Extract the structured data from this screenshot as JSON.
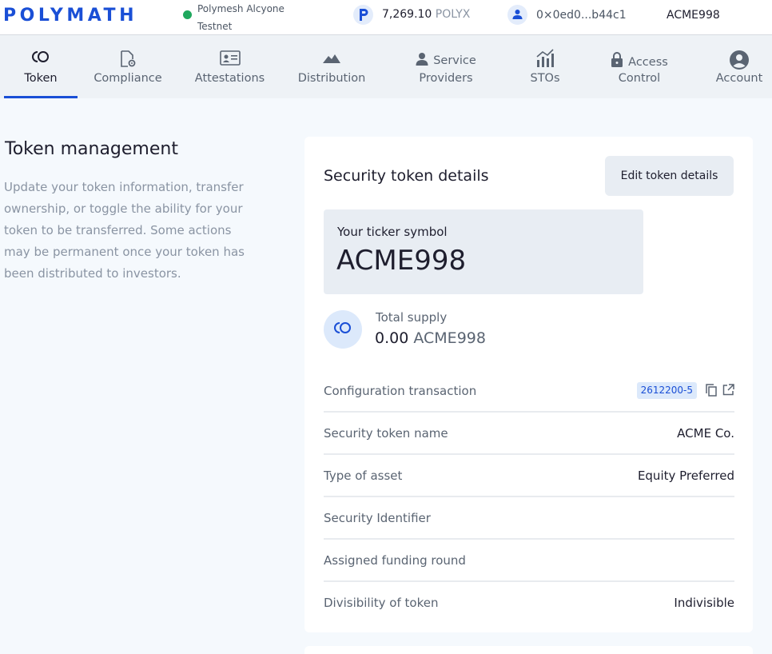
{
  "header": {
    "logo": "POLYMATH",
    "network_line1": "Polymesh Alcyone",
    "network_line2": "Testnet",
    "balance_value": "7,269.10",
    "balance_unit": "POLYX",
    "address": "0×0ed0...b44c1",
    "ticker": "ACME998",
    "colors": {
      "brand": "#1a4fd6",
      "network_status": "#1fa85e"
    }
  },
  "tabs": [
    {
      "label": "Token",
      "icon": "token-icon",
      "active": true
    },
    {
      "label": "Compliance",
      "icon": "document-gear-icon"
    },
    {
      "label": "Attestations",
      "icon": "id-card-icon"
    },
    {
      "label": "Distribution",
      "icon": "mountain-icon"
    },
    {
      "label_line1": "Service",
      "label_line2": "Providers",
      "icon": "person-icon"
    },
    {
      "label": "STOs",
      "icon": "bar-chart-icon"
    },
    {
      "label_line1": "Access",
      "label_line2": "Control",
      "icon": "lock-icon"
    },
    {
      "label": "Account",
      "icon": "account-circle-icon"
    }
  ],
  "page": {
    "title": "Token management",
    "description": "Update your token information, transfer ownership, or toggle the ability for your token to be transferred. Some actions may be permanent once your token has been distributed to investors."
  },
  "card": {
    "title": "Security token details",
    "edit_button": "Edit token details",
    "ticker_label": "Your ticker symbol",
    "ticker_value": "ACME998",
    "supply_label": "Total supply",
    "supply_value": "0.00",
    "supply_unit": "ACME998",
    "rows": [
      {
        "label": "Configuration transaction",
        "badge": "2612200-5"
      },
      {
        "label": "Security token name",
        "value": "ACME Co."
      },
      {
        "label": "Type of asset",
        "value": "Equity Preferred"
      },
      {
        "label": "Security Identifier",
        "value": ""
      },
      {
        "label": "Assigned funding round",
        "value": ""
      },
      {
        "label": "Divisibility of token",
        "value": "Indivisible"
      }
    ]
  }
}
